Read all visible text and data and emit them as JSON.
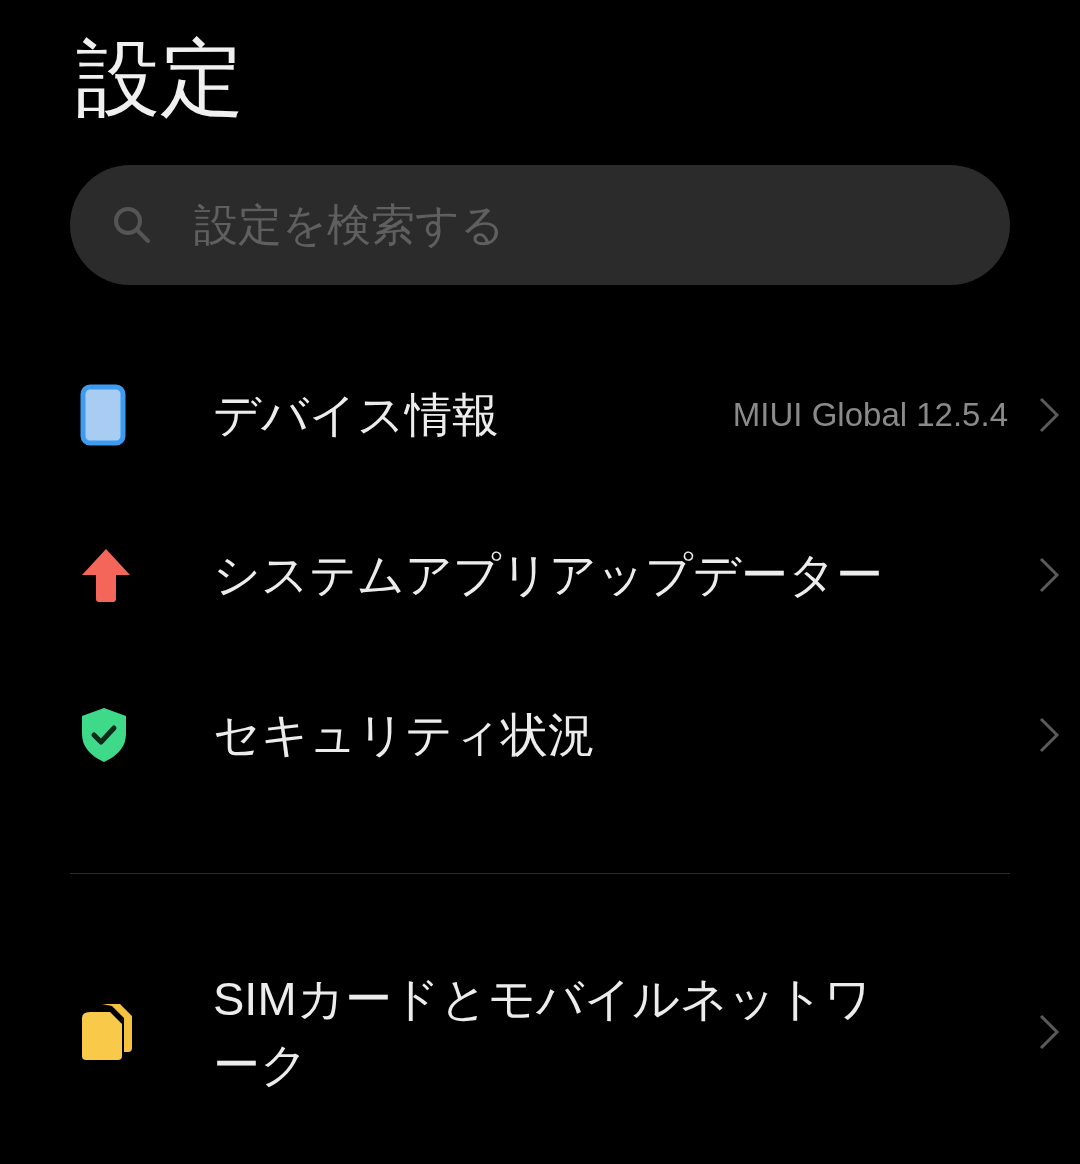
{
  "title": "設定",
  "search": {
    "placeholder": "設定を検索する"
  },
  "groups": [
    {
      "items": [
        {
          "kind": "device",
          "label": "デバイス情報",
          "value": "MIUI Global 12.5.4"
        },
        {
          "kind": "update",
          "label": "システムアプリアップデーター"
        },
        {
          "kind": "security",
          "label": "セキュリティ状況"
        }
      ]
    },
    {
      "items": [
        {
          "kind": "sim",
          "label": "SIMカードとモバイルネットワーク"
        }
      ]
    }
  ]
}
